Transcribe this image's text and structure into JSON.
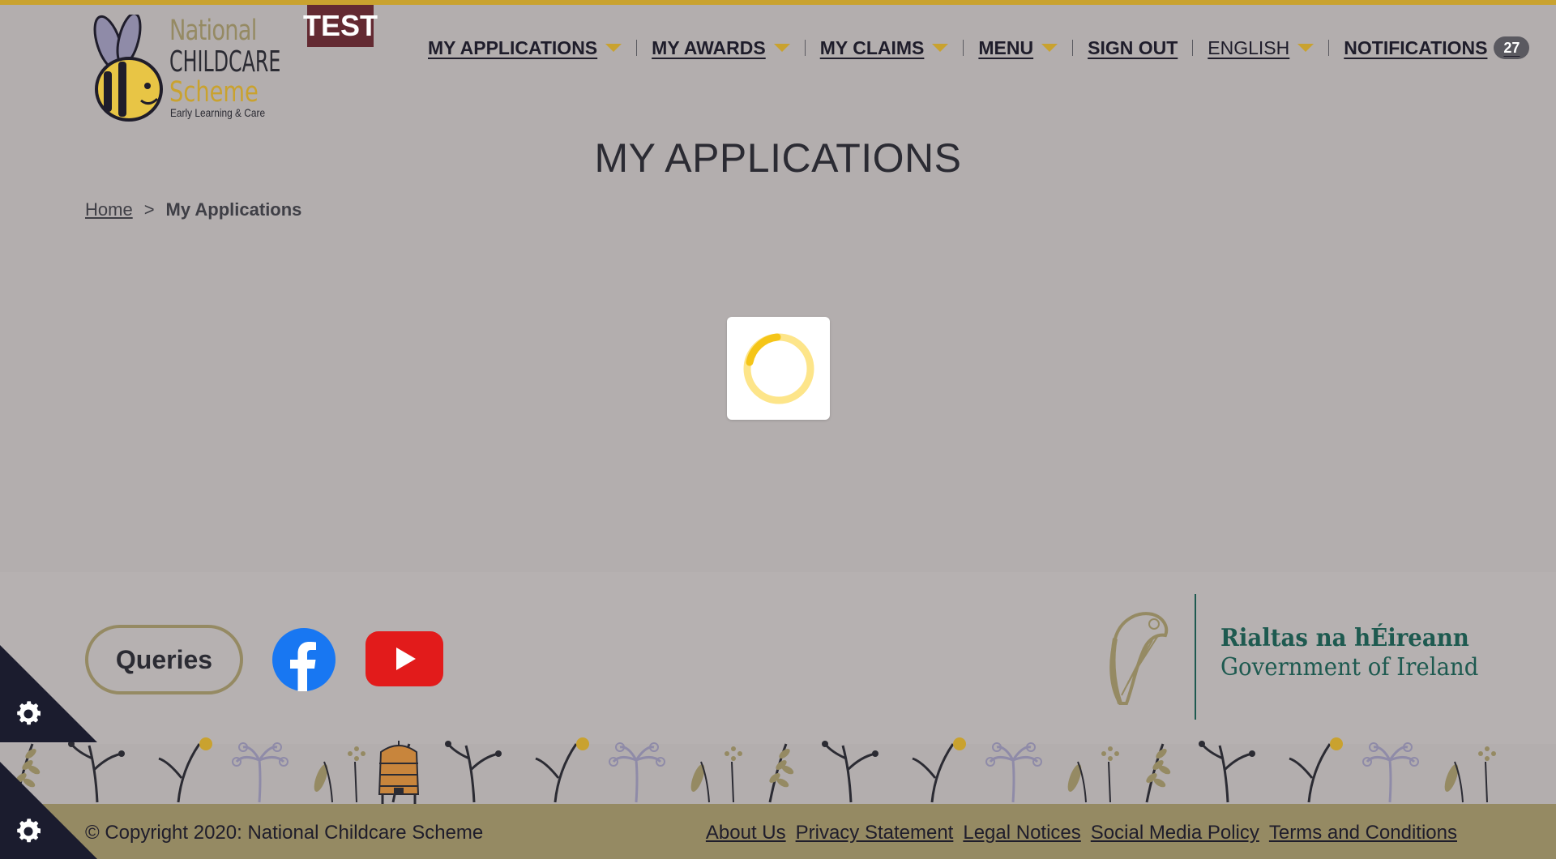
{
  "logo": {
    "line1": "National",
    "line2": "CHILDCARE",
    "line3": "Scheme",
    "line4": "Early Learning & Care"
  },
  "env_badge": "TEST",
  "nav": {
    "my_applications": "MY APPLICATIONS",
    "my_awards": "MY AWARDS",
    "my_claims": "MY CLAIMS",
    "menu": "MENU",
    "sign_out": "SIGN OUT",
    "language": "ENGLISH",
    "notifications": "NOTIFICATIONS",
    "notifications_count": "27"
  },
  "page": {
    "title": "MY APPLICATIONS"
  },
  "breadcrumb": {
    "home": "Home",
    "separator": ">",
    "current": "My Applications"
  },
  "footer": {
    "queries_label": "Queries",
    "gov_line1": "Rialtas na hÉireann",
    "gov_line2": "Government of Ireland",
    "copyright": "© Copyright 2020: National Childcare Scheme",
    "links": {
      "about": "About Us",
      "privacy": "Privacy Statement",
      "legal": "Legal Notices",
      "social": "Social Media Policy",
      "terms": "Terms and Conditions"
    }
  },
  "icons": {
    "facebook": "facebook-icon",
    "youtube": "youtube-icon",
    "cookie_settings": "gear-icon",
    "loading": "spinner-icon"
  },
  "colors": {
    "accent": "#c9a22f",
    "background": "#b3aeae",
    "test_badge": "#632a32",
    "footer_bar": "#958a63",
    "gov_green": "#1e5a50",
    "cookie_tab": "#1b1c2e"
  }
}
